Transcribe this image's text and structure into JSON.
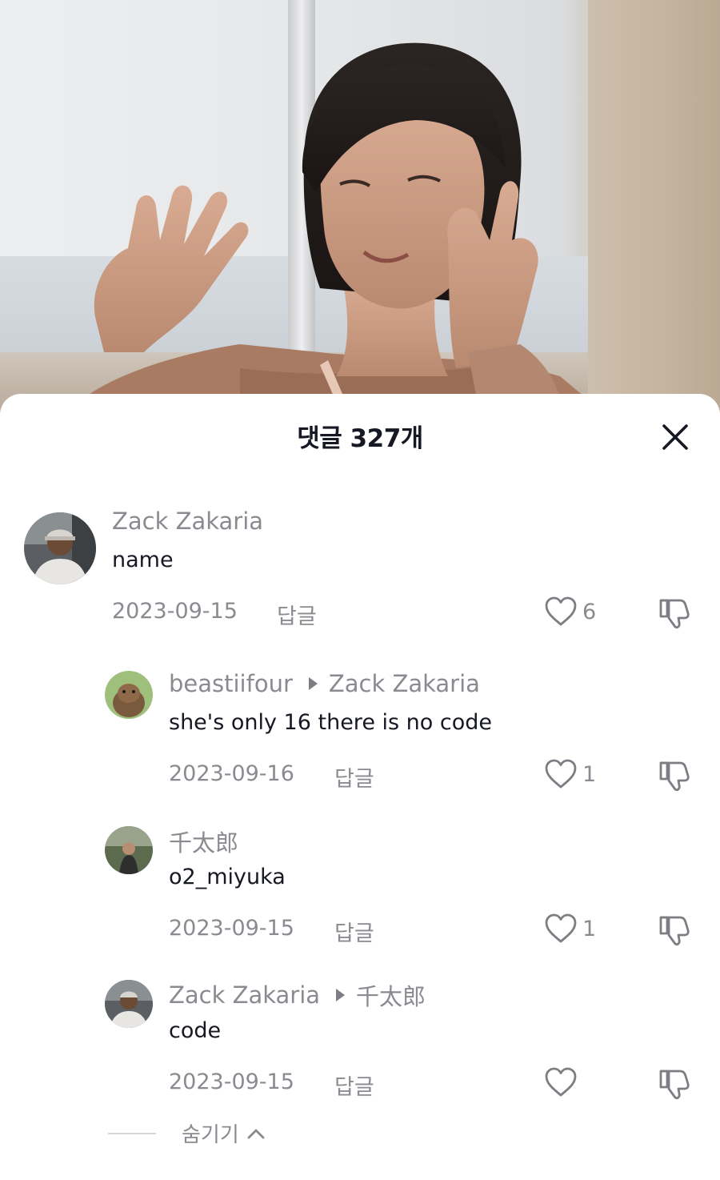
{
  "sheet": {
    "title": "댓글 327개",
    "hide_label": "숨기기"
  },
  "comments": [
    {
      "user": "Zack Zakaria",
      "reply_to": "",
      "text": "name",
      "date": "2023-09-15",
      "reply_label": "답글",
      "likes": "6"
    },
    {
      "user": "beastiifour",
      "reply_to": "Zack Zakaria",
      "text": "she's only 16 there is no code",
      "date": "2023-09-16",
      "reply_label": "답글",
      "likes": "1"
    },
    {
      "user": "千太郎",
      "reply_to": "",
      "text": "o2_miyuka",
      "date": "2023-09-15",
      "reply_label": "답글",
      "likes": "1"
    },
    {
      "user": "Zack Zakaria",
      "reply_to": "千太郎",
      "text": "code",
      "date": "2023-09-15",
      "reply_label": "답글",
      "likes": ""
    }
  ],
  "colors": {
    "primary_text": "#161823",
    "secondary_text": "#8a8b91",
    "sheet_bg": "#ffffff"
  },
  "icons": {
    "close": "close-icon",
    "like": "heart-outline-icon",
    "dislike": "thumbs-down-icon",
    "hide": "chevron-up-icon"
  }
}
